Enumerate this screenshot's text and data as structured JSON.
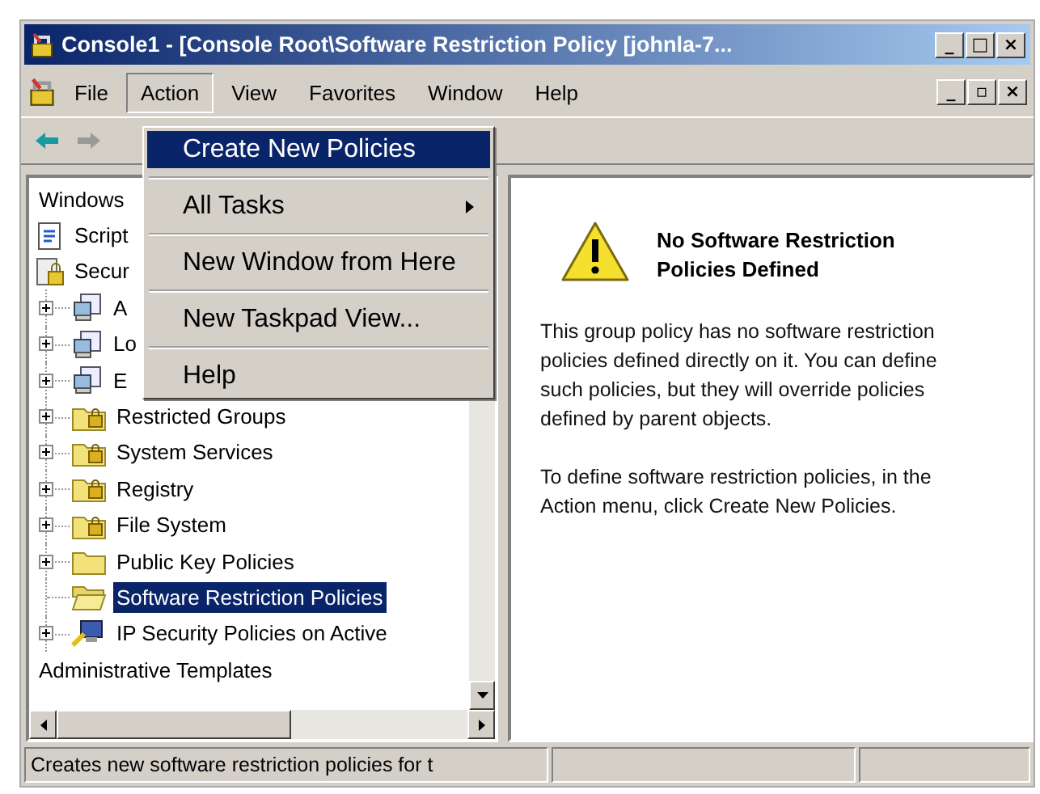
{
  "window": {
    "title": "Console1 - [Console Root\\Software Restriction Policy [johnla-7...",
    "controls": [
      "_",
      "□",
      "×"
    ]
  },
  "menu_bar": {
    "items": [
      {
        "label": "File",
        "selected": false
      },
      {
        "label": "Action",
        "selected": true
      },
      {
        "label": "View",
        "selected": false
      },
      {
        "label": "Favorites",
        "selected": false
      },
      {
        "label": "Window",
        "selected": false
      },
      {
        "label": "Help",
        "selected": false
      }
    ],
    "child_controls": [
      "_",
      "▫",
      "×"
    ]
  },
  "toolbar": {
    "buttons": [
      {
        "kind": "back",
        "disabled": false
      },
      {
        "kind": "forward",
        "disabled": true
      }
    ]
  },
  "action_menu": {
    "items": [
      {
        "label": "Create New Policies",
        "selected": true,
        "submenu": false
      },
      {
        "label": "All Tasks",
        "selected": false,
        "submenu": true
      },
      {
        "label": "New Window from Here",
        "selected": false,
        "submenu": false
      },
      {
        "label": "New Taskpad View...",
        "selected": false,
        "submenu": false
      },
      {
        "label": "Help",
        "selected": false,
        "submenu": false
      }
    ]
  },
  "tree": {
    "items": [
      {
        "label": "Windows",
        "kind": "none",
        "selected": false
      },
      {
        "label": "Script",
        "kind": "script",
        "selected": false
      },
      {
        "label": "Secur",
        "kind": "security",
        "selected": false,
        "children": [
          {
            "label": "A",
            "kind": "policy",
            "selected": false,
            "expanded": false
          },
          {
            "label": "Lo",
            "kind": "policy",
            "selected": false,
            "expanded": false
          },
          {
            "label": "E",
            "kind": "policy",
            "selected": false,
            "expanded": false
          },
          {
            "label": "Restricted Groups",
            "kind": "locked-folder",
            "selected": false,
            "expanded": false
          },
          {
            "label": "System Services",
            "kind": "locked-folder",
            "selected": false,
            "expanded": false
          },
          {
            "label": "Registry",
            "kind": "locked-folder",
            "selected": false,
            "expanded": false
          },
          {
            "label": "File System",
            "kind": "locked-folder",
            "selected": false,
            "expanded": false
          },
          {
            "label": "Public Key Policies",
            "kind": "folder",
            "selected": false,
            "expanded": false
          },
          {
            "label": "Software Restriction Policies",
            "kind": "open-folder",
            "selected": true
          },
          {
            "label": "IP Security Policies on Active",
            "kind": "ip",
            "selected": false,
            "expanded": false
          }
        ]
      },
      {
        "label": "Administrative Templates",
        "kind": "none",
        "selected": false
      }
    ]
  },
  "detail": {
    "heading": "No Software Restriction Policies Defined",
    "paragraphs": [
      "This group policy has no software restriction policies defined directly on it. You can define such policies, but they will override policies defined by parent objects.",
      "To define software restriction policies, in the Action menu, click Create New Policies."
    ]
  },
  "status_bar": {
    "text": "Creates new software restriction policies for t"
  }
}
